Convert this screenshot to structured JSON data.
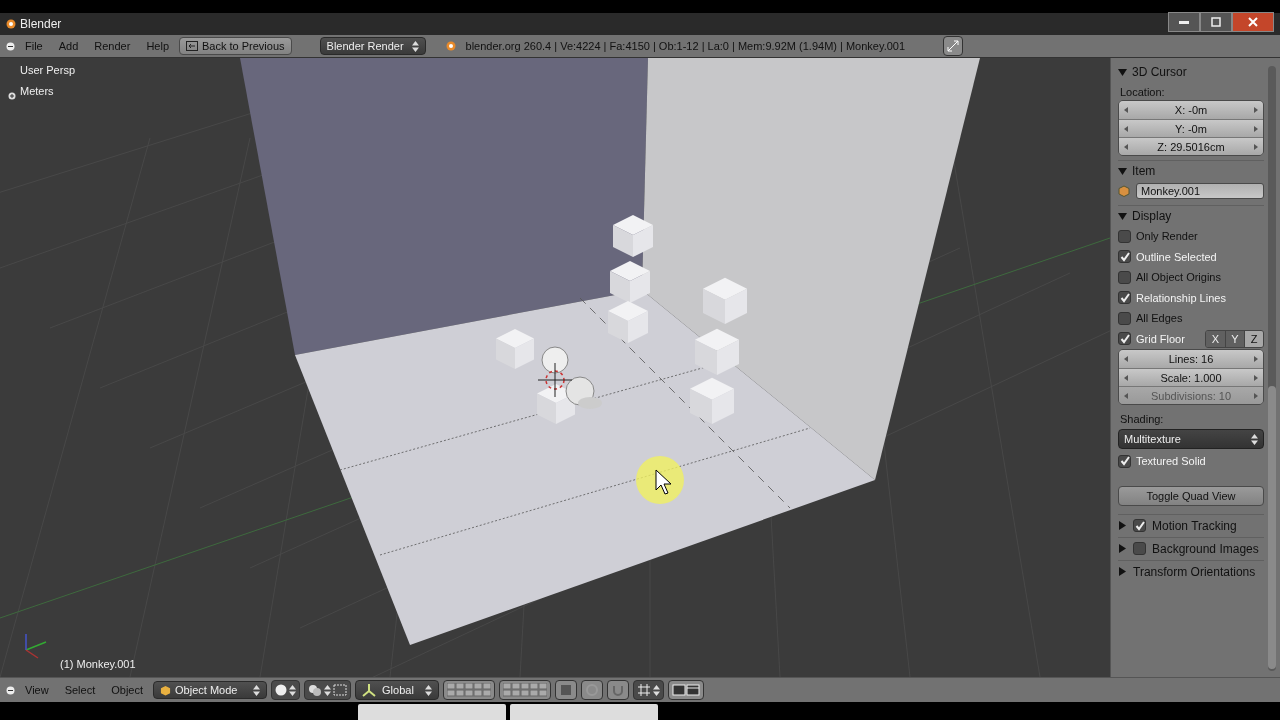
{
  "window": {
    "title": "Blender"
  },
  "top_header": {
    "menus": [
      "File",
      "Add",
      "Render",
      "Help"
    ],
    "back_button": "Back to Previous",
    "render_engine": "Blender Render",
    "stats": "blender.org 260.4 | Ve:4224 | Fa:4150 | Ob:1-12 | La:0 | Mem:9.92M (1.94M) | Monkey.001"
  },
  "viewport": {
    "view_name": "User Persp",
    "units": "Meters",
    "object_info": "(1) Monkey.001"
  },
  "properties": {
    "cursor": {
      "title": "3D Cursor",
      "expanded": true,
      "location_label": "Location:",
      "fields": [
        "X: -0m",
        "Y: -0m",
        "Z: 29.5016cm"
      ]
    },
    "item": {
      "title": "Item",
      "expanded": true,
      "name": "Monkey.001"
    },
    "display": {
      "title": "Display",
      "expanded": true,
      "options": [
        {
          "label": "Only Render",
          "checked": false
        },
        {
          "label": "Outline Selected",
          "checked": true
        },
        {
          "label": "All Object Origins",
          "checked": false
        },
        {
          "label": "Relationship Lines",
          "checked": true
        },
        {
          "label": "All Edges",
          "checked": false
        }
      ],
      "grid_floor": {
        "label": "Grid Floor",
        "checked": true,
        "axes": [
          {
            "label": "X",
            "selected": false
          },
          {
            "label": "Y",
            "selected": false
          },
          {
            "label": "Z",
            "selected": true
          }
        ]
      },
      "grid_fields": [
        {
          "label": "Lines: 16",
          "disabled": false
        },
        {
          "label": "Scale: 1.000",
          "disabled": false
        },
        {
          "label": "Subdivisions: 10",
          "disabled": true
        }
      ],
      "shading_label": "Shading:",
      "shading": "Multitexture",
      "textured_solid": {
        "label": "Textured Solid",
        "checked": true
      },
      "quad_button": "Toggle Quad View"
    },
    "collapsed": [
      {
        "title": "Motion Tracking",
        "expanded": false,
        "kind": "checkbox",
        "checked": true
      },
      {
        "title": "Background Images",
        "expanded": false,
        "kind": "checkbox",
        "checked": false
      },
      {
        "title": "Transform Orientations",
        "expanded": false,
        "kind": "plain"
      }
    ]
  },
  "bottom_header": {
    "menus": [
      "View",
      "Select",
      "Object"
    ],
    "mode": "Object Mode",
    "orientation": "Global"
  }
}
